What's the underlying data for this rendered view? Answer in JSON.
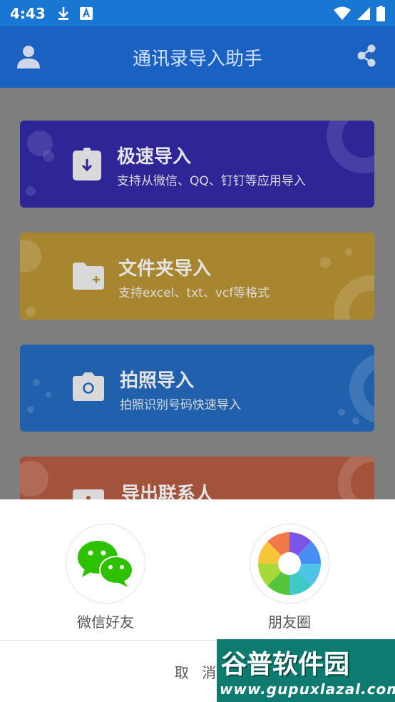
{
  "status_bar": {
    "time": "4:43",
    "icons_left": [
      "download-icon",
      "a-badge-icon"
    ],
    "icons_right": [
      "wifi-icon",
      "signal-icon",
      "battery-icon"
    ]
  },
  "app_bar": {
    "title": "通讯录导入助手",
    "left_icon": "person-icon",
    "right_icon": "share-icon"
  },
  "cards": [
    {
      "title": "极速导入",
      "subtitle": "支持从微信、QQ、钉钉等应用导入",
      "icon": "import-icon",
      "color": "#2e2597"
    },
    {
      "title": "文件夹导入",
      "subtitle": "支持excel、txt、vcf等格式",
      "icon": "folder-add-icon",
      "color": "#a8862f"
    },
    {
      "title": "拍照导入",
      "subtitle": "拍照识别号码快速导入",
      "icon": "camera-icon",
      "color": "#2060ad"
    },
    {
      "title": "导出联系人",
      "subtitle": "",
      "icon": "export-icon",
      "color": "#a3523b"
    }
  ],
  "share_sheet": {
    "options": [
      {
        "label": "微信好友",
        "icon": "wechat-icon"
      },
      {
        "label": "朋友圈",
        "icon": "moments-icon"
      }
    ],
    "cancel_label": "取 消"
  },
  "watermark": {
    "text": "谷普软件园",
    "url": "www.gupuxlazal.com"
  }
}
